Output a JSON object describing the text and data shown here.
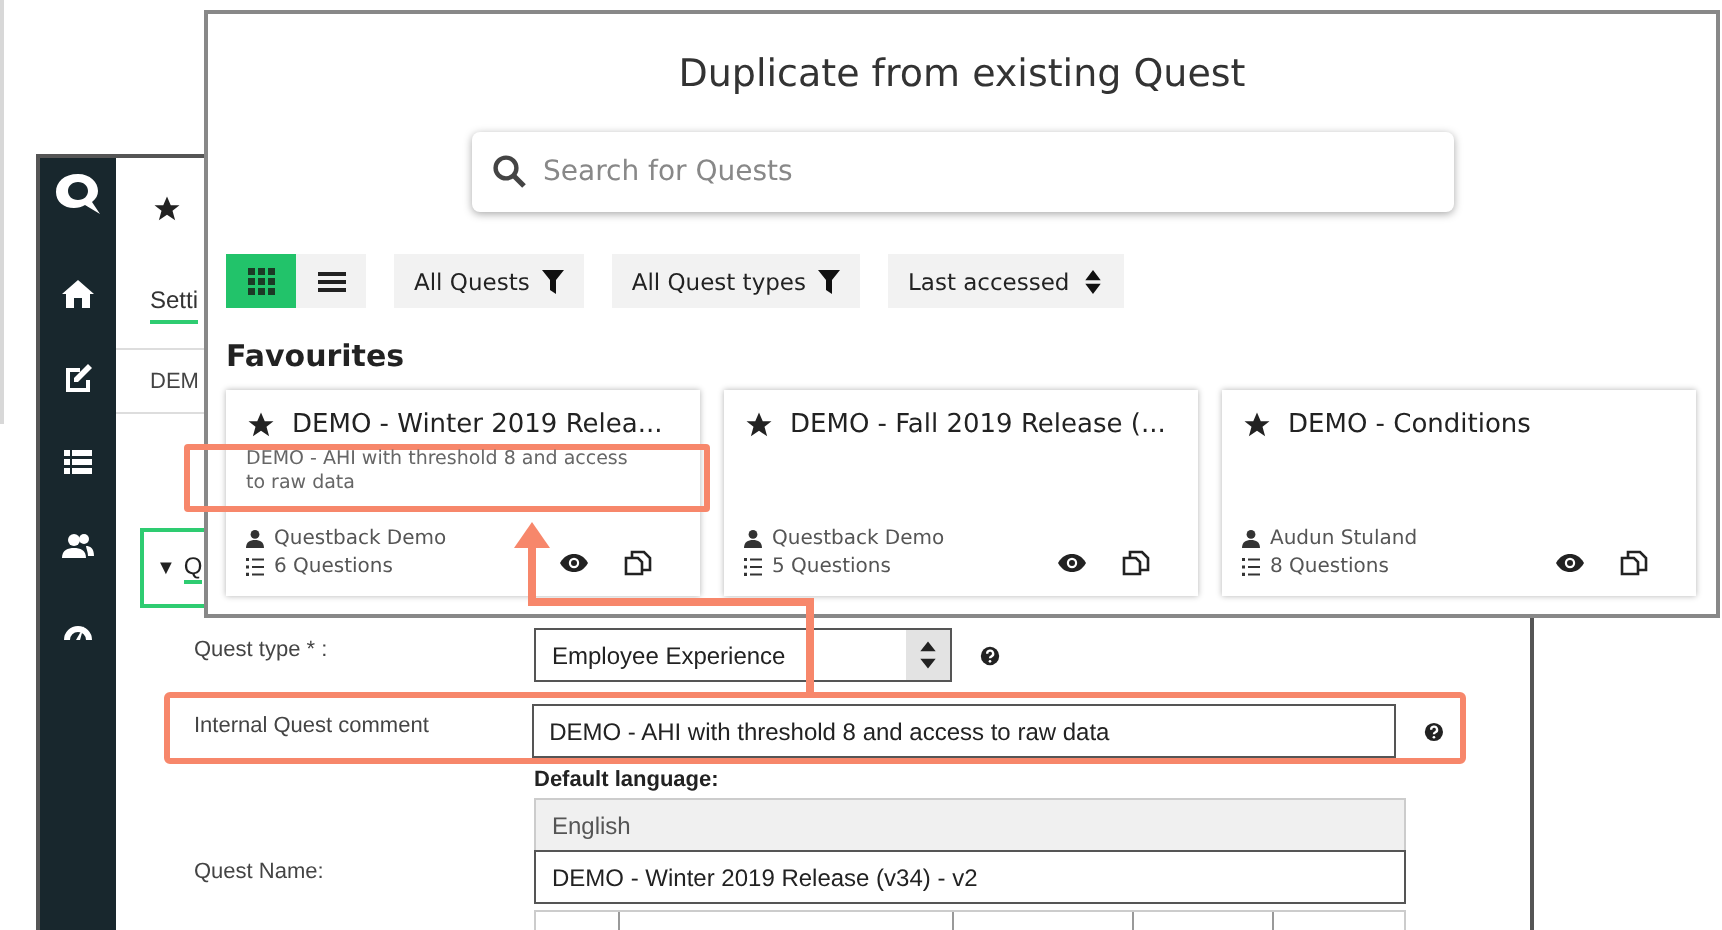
{
  "app": {
    "tab": {
      "label": "Setti",
      "selected": true
    },
    "breadcrumb": "DEM",
    "section": {
      "toggle": "▼",
      "title": "Q"
    },
    "form": [
      {
        "kind": "select",
        "label": "Quest type * :",
        "value": "Employee Experience",
        "help": true,
        "highlighted": false
      },
      {
        "kind": "text",
        "label": "Internal Quest comment",
        "value": "DEMO - AHI with threshold 8 and access to raw data",
        "help": true,
        "highlighted": true
      },
      {
        "kind": "readonly",
        "caption": "Default language:",
        "value": "English"
      },
      {
        "kind": "text",
        "label": "Quest Name:",
        "value": "DEMO - Winter 2019 Release (v34) - v2",
        "help": false,
        "highlighted": false
      }
    ]
  },
  "dialog": {
    "title": "Duplicate from existing Quest",
    "search": {
      "placeholder": "Search for Quests"
    },
    "view_modes": [
      {
        "kind": "grid",
        "selected": true
      },
      {
        "kind": "list",
        "selected": false
      }
    ],
    "filters": [
      {
        "kind": "filter",
        "label": "All Quests"
      },
      {
        "kind": "filter",
        "label": "All Quest types"
      },
      {
        "kind": "sort",
        "label": "Last accessed"
      }
    ],
    "section_title": "Favourites",
    "cards": [
      {
        "title": "DEMO - Winter 2019 Relea...",
        "favourite": true,
        "description": "DEMO - AHI with threshold 8 and access to raw data",
        "highlighted": true,
        "author": "Questback Demo",
        "questions": "6 Questions"
      },
      {
        "title": "DEMO - Fall 2019 Release (...",
        "favourite": true,
        "author": "Questback Demo",
        "questions": "5 Questions",
        "highlighted": false
      },
      {
        "title": "DEMO - Conditions",
        "favourite": true,
        "author": "Audun Stuland",
        "questions": "8 Questions",
        "highlighted": false
      }
    ]
  }
}
